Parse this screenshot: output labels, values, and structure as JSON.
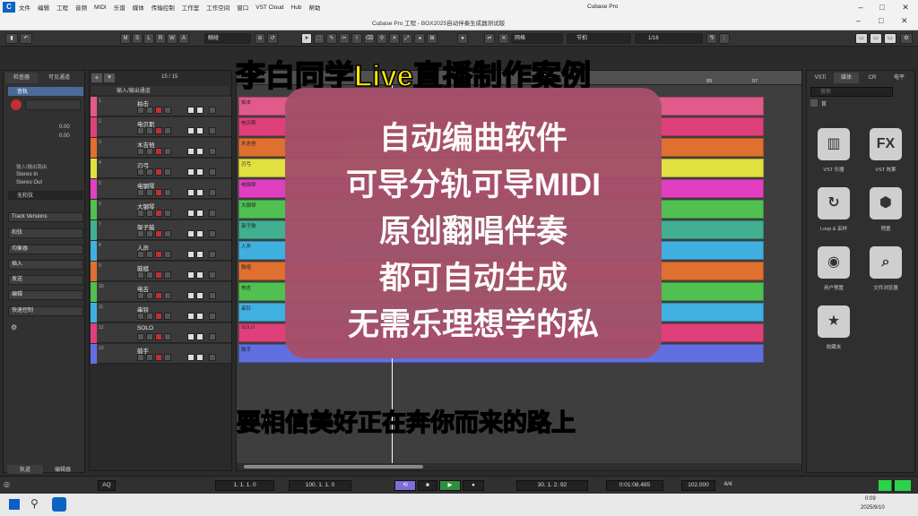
{
  "menubar": {
    "logo": "C",
    "items": [
      "文件",
      "编辑",
      "工程",
      "音频",
      "MIDI",
      "乐谱",
      "媒体",
      "传输控制",
      "工作室",
      "工作空间",
      "窗口",
      "VST Cloud",
      "Hub",
      "帮助"
    ],
    "app_name": "Cubase Pro",
    "min": "–",
    "max": "□",
    "close": "✕"
  },
  "titlebar": {
    "title": "Cubase Pro 工程 - BOX2025自动伴奏生成器测试版",
    "min": "–",
    "max": "□",
    "close": "✕"
  },
  "toolbar": {
    "buttons": [
      "M",
      "S",
      "L",
      "R",
      "W",
      "A"
    ],
    "touch_label": "触碰",
    "grid_label": "网格",
    "snap_label": "节拍",
    "quantize_value": "1/16"
  },
  "left_panel": {
    "tabs": [
      "检查器",
      "可见通道"
    ],
    "track_name": "音轨",
    "level1": "0.00",
    "level2": "0.00",
    "routing_in": "Stereo In",
    "routing_out": "Stereo Out",
    "routing_header": "输入/输出路由",
    "chord_track": "无和弦",
    "sections": [
      "Track Versions",
      "和弦",
      "均衡器",
      "插入",
      "发送",
      "编辑",
      "快速控制"
    ],
    "bottom_tabs": [
      "轨道",
      "编辑器"
    ]
  },
  "tracklist": {
    "counter": "15 / 15",
    "header_name": "输入/输出通道",
    "tracks": [
      {
        "num": "1",
        "name": "拍击",
        "color": "#e05a8a"
      },
      {
        "num": "2",
        "name": "电贝斯",
        "color": "#e0407a"
      },
      {
        "num": "3",
        "name": "木吉他",
        "color": "#e07030"
      },
      {
        "num": "4",
        "name": "刃弓",
        "color": "#e0e040"
      },
      {
        "num": "5",
        "name": "电钢琴",
        "color": "#e040c0"
      },
      {
        "num": "6",
        "name": "大钢琴",
        "color": "#50c050"
      },
      {
        "num": "7",
        "name": "架子鼓",
        "color": "#40b090"
      },
      {
        "num": "8",
        "name": "人声",
        "color": "#40b0e0"
      },
      {
        "num": "9",
        "name": "鼓组",
        "color": "#e07030"
      },
      {
        "num": "10",
        "name": "电吉",
        "color": "#50c050"
      },
      {
        "num": "11",
        "name": "串铃",
        "color": "#40b0e0"
      },
      {
        "num": "12",
        "name": "SOLO",
        "color": "#e0407a"
      },
      {
        "num": "13",
        "name": "鼓手",
        "color": "#6070e0"
      }
    ]
  },
  "arrange": {
    "ruler_marks": [
      "1",
      "89",
      "97"
    ],
    "clip_labels": [
      "拍击",
      "电贝斯",
      "木吉他",
      "刃弓",
      "电钢琴",
      "大钢琴",
      "架子鼓",
      "人声",
      "鼓组",
      "电吉",
      "串铃",
      "SOLO",
      "鼓手"
    ]
  },
  "right_panel": {
    "tabs": [
      "VSTi",
      "媒体",
      "CR",
      "电平"
    ],
    "search_placeholder": "搜索",
    "home": "首",
    "items": [
      {
        "icon": "piano-icon",
        "glyph": "▥",
        "label": "VST 乐器"
      },
      {
        "icon": "fx-icon",
        "glyph": "FX",
        "label": "VST 效果"
      },
      {
        "icon": "loop-icon",
        "glyph": "↻",
        "label": "Loop & 采样"
      },
      {
        "icon": "preset-icon",
        "glyph": "⬢",
        "label": "预置"
      },
      {
        "icon": "user-preset-icon",
        "glyph": "◉",
        "label": "用户预置"
      },
      {
        "icon": "file-browser-icon",
        "glyph": "⌕",
        "label": "文件浏览器"
      },
      {
        "icon": "favorites-icon",
        "glyph": "★",
        "label": "收藏夹"
      }
    ]
  },
  "transport": {
    "left_locator": "1. 1. 1.  0",
    "right_locator": "100. 1. 1.  0",
    "position": "30. 1. 2. 92",
    "time": "0:01:08.495",
    "tempo": "102.000",
    "signature": "4/4",
    "aq": "AQ"
  },
  "taskbar": {
    "time": "0:09",
    "date": "2025/9/10"
  },
  "overlay": {
    "title": "李白同学Live直播制作案例",
    "lines": [
      "自动编曲软件",
      "可导分轨可导MIDI",
      "原创翻唱伴奏",
      "都可自动生成",
      "无需乐理想学的私"
    ],
    "subtitle": "要相信美好正在奔你而来的路上"
  }
}
